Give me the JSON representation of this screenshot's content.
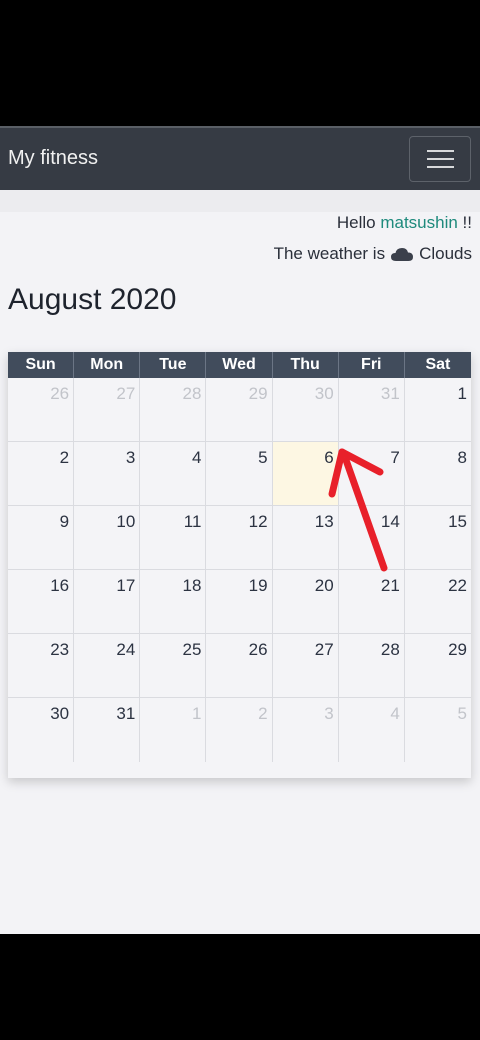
{
  "navbar": {
    "brand": "My fitness",
    "menu_icon": "hamburger-icon"
  },
  "greeting": {
    "prefix": "Hello ",
    "username": "matsushin",
    "suffix": " !!"
  },
  "weather": {
    "prefix": "The weather is",
    "icon": "cloud-icon",
    "condition": "Clouds"
  },
  "calendar": {
    "title": "August 2020",
    "weekdays": [
      "Sun",
      "Mon",
      "Tue",
      "Wed",
      "Thu",
      "Fri",
      "Sat"
    ],
    "days": [
      {
        "n": "26",
        "other": true
      },
      {
        "n": "27",
        "other": true
      },
      {
        "n": "28",
        "other": true
      },
      {
        "n": "29",
        "other": true
      },
      {
        "n": "30",
        "other": true
      },
      {
        "n": "31",
        "other": true
      },
      {
        "n": "1"
      },
      {
        "n": "2"
      },
      {
        "n": "3"
      },
      {
        "n": "4"
      },
      {
        "n": "5"
      },
      {
        "n": "6",
        "today": true
      },
      {
        "n": "7"
      },
      {
        "n": "8"
      },
      {
        "n": "9"
      },
      {
        "n": "10"
      },
      {
        "n": "11"
      },
      {
        "n": "12"
      },
      {
        "n": "13"
      },
      {
        "n": "14"
      },
      {
        "n": "15"
      },
      {
        "n": "16"
      },
      {
        "n": "17"
      },
      {
        "n": "18"
      },
      {
        "n": "19"
      },
      {
        "n": "20"
      },
      {
        "n": "21"
      },
      {
        "n": "22"
      },
      {
        "n": "23"
      },
      {
        "n": "24"
      },
      {
        "n": "25"
      },
      {
        "n": "26"
      },
      {
        "n": "27"
      },
      {
        "n": "28"
      },
      {
        "n": "29"
      },
      {
        "n": "30"
      },
      {
        "n": "31"
      },
      {
        "n": "1",
        "other": true
      },
      {
        "n": "2",
        "other": true
      },
      {
        "n": "3",
        "other": true
      },
      {
        "n": "4",
        "other": true
      },
      {
        "n": "5",
        "other": true
      }
    ]
  },
  "colors": {
    "navbar": "#363b44",
    "header": "#414c5c",
    "today": "#fdf7e3",
    "accent": "#1e8a7c",
    "arrow": "#e8202a"
  }
}
